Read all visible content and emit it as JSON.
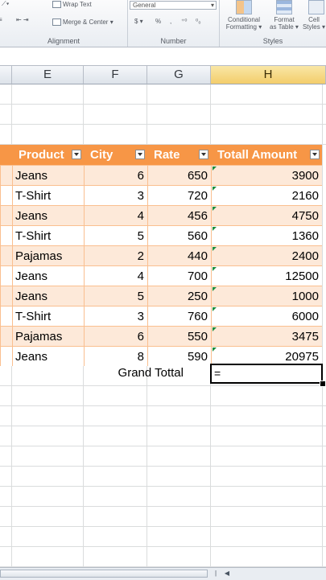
{
  "ribbon": {
    "wrap_text": "Wrap Text",
    "merge_center": "Merge & Center",
    "alignment_label": "Alignment",
    "number_format": "General",
    "currency": "$",
    "percent": "%",
    "comma": ",",
    "number_label": "Number",
    "conditional_formatting": [
      "Conditional",
      "Formatting"
    ],
    "format_as_table": [
      "Format",
      "as Table"
    ],
    "cell_styles": [
      "Cell",
      "Styles"
    ],
    "styles_label": "Styles"
  },
  "columns": [
    "E",
    "F",
    "G",
    "H"
  ],
  "table": {
    "headers": [
      "Product",
      "City",
      "Rate",
      "Totall Amount"
    ],
    "rows": [
      {
        "product": "Jeans",
        "city": "6",
        "rate": "650",
        "amount": "3900"
      },
      {
        "product": "T-Shirt",
        "city": "3",
        "rate": "720",
        "amount": "2160"
      },
      {
        "product": "Jeans",
        "city": "4",
        "rate": "456",
        "amount": "4750"
      },
      {
        "product": "T-Shirt",
        "city": "5",
        "rate": "560",
        "amount": "1360"
      },
      {
        "product": "Pajamas",
        "city": "2",
        "rate": "440",
        "amount": "2400"
      },
      {
        "product": "Jeans",
        "city": "4",
        "rate": "700",
        "amount": "12500"
      },
      {
        "product": "Jeans",
        "city": "5",
        "rate": "250",
        "amount": "1000"
      },
      {
        "product": "T-Shirt",
        "city": "3",
        "rate": "760",
        "amount": "6000"
      },
      {
        "product": "Pajamas",
        "city": "6",
        "rate": "550",
        "amount": "3475"
      },
      {
        "product": "Jeans",
        "city": "8",
        "rate": "590",
        "amount": "20975"
      }
    ]
  },
  "grand_total_label": "Grand Tottal",
  "active_cell_value": "=",
  "colors": {
    "header": "#f79646",
    "band": "#fde9d9",
    "selected_column": "#f3cd6b"
  }
}
